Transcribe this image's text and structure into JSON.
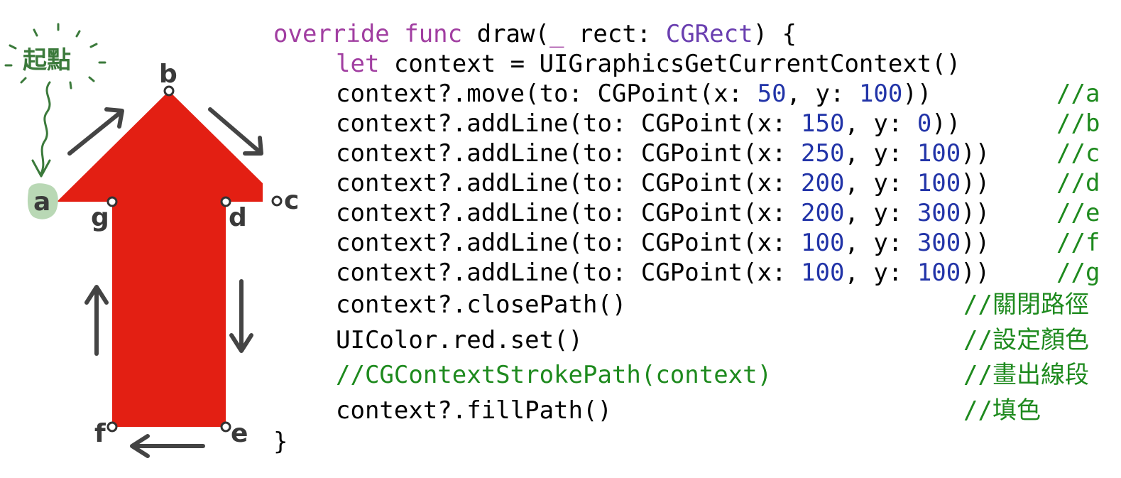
{
  "diagram": {
    "start_label": "起點",
    "points": {
      "a": "a",
      "b": "b",
      "c": "c",
      "d": "d",
      "e": "e",
      "f": "f",
      "g": "g"
    },
    "fill_color": "#e31f13",
    "arrow_color": "#444444",
    "start_color": "#3b7a3b"
  },
  "code": {
    "header": {
      "kw": "override func",
      "name": "draw(",
      "p1": "_",
      "p2": " rect: ",
      "type": "CGRect",
      "tail": ") {"
    },
    "let_line": {
      "kw": "let",
      "rest": " context = UIGraphicsGetCurrentContext()"
    },
    "path_lines": [
      {
        "prefix": "context?.move(to: CGPoint(x: ",
        "x": "50",
        "mid": ", y: ",
        "y": "100",
        "suffix": "))",
        "comment": "//a"
      },
      {
        "prefix": "context?.addLine(to: CGPoint(x: ",
        "x": "150",
        "mid": ", y: ",
        "y": "0",
        "suffix": "))",
        "comment": "//b"
      },
      {
        "prefix": "context?.addLine(to: CGPoint(x: ",
        "x": "250",
        "mid": ", y: ",
        "y": "100",
        "suffix": "))",
        "comment": "//c"
      },
      {
        "prefix": "context?.addLine(to: CGPoint(x: ",
        "x": "200",
        "mid": ", y: ",
        "y": "100",
        "suffix": "))",
        "comment": "//d"
      },
      {
        "prefix": "context?.addLine(to: CGPoint(x: ",
        "x": "200",
        "mid": ", y: ",
        "y": "300",
        "suffix": "))",
        "comment": "//e"
      },
      {
        "prefix": "context?.addLine(to: CGPoint(x: ",
        "x": "100",
        "mid": ", y: ",
        "y": "300",
        "suffix": "))",
        "comment": "//f"
      },
      {
        "prefix": "context?.addLine(to: CGPoint(x: ",
        "x": "100",
        "mid": ", y: ",
        "y": "100",
        "suffix": "))",
        "comment": "//g"
      }
    ],
    "close_path": {
      "code": "context?.closePath()",
      "comment": "//關閉路徑"
    },
    "set_color": {
      "code": "UIColor.red.set()",
      "comment": "//設定顏色"
    },
    "stroke": {
      "code": "//CGContextStrokePath(context)",
      "comment": "//畫出線段"
    },
    "fill": {
      "code": "context?.fillPath()",
      "comment": "//填色"
    },
    "closing_brace": "}"
  }
}
